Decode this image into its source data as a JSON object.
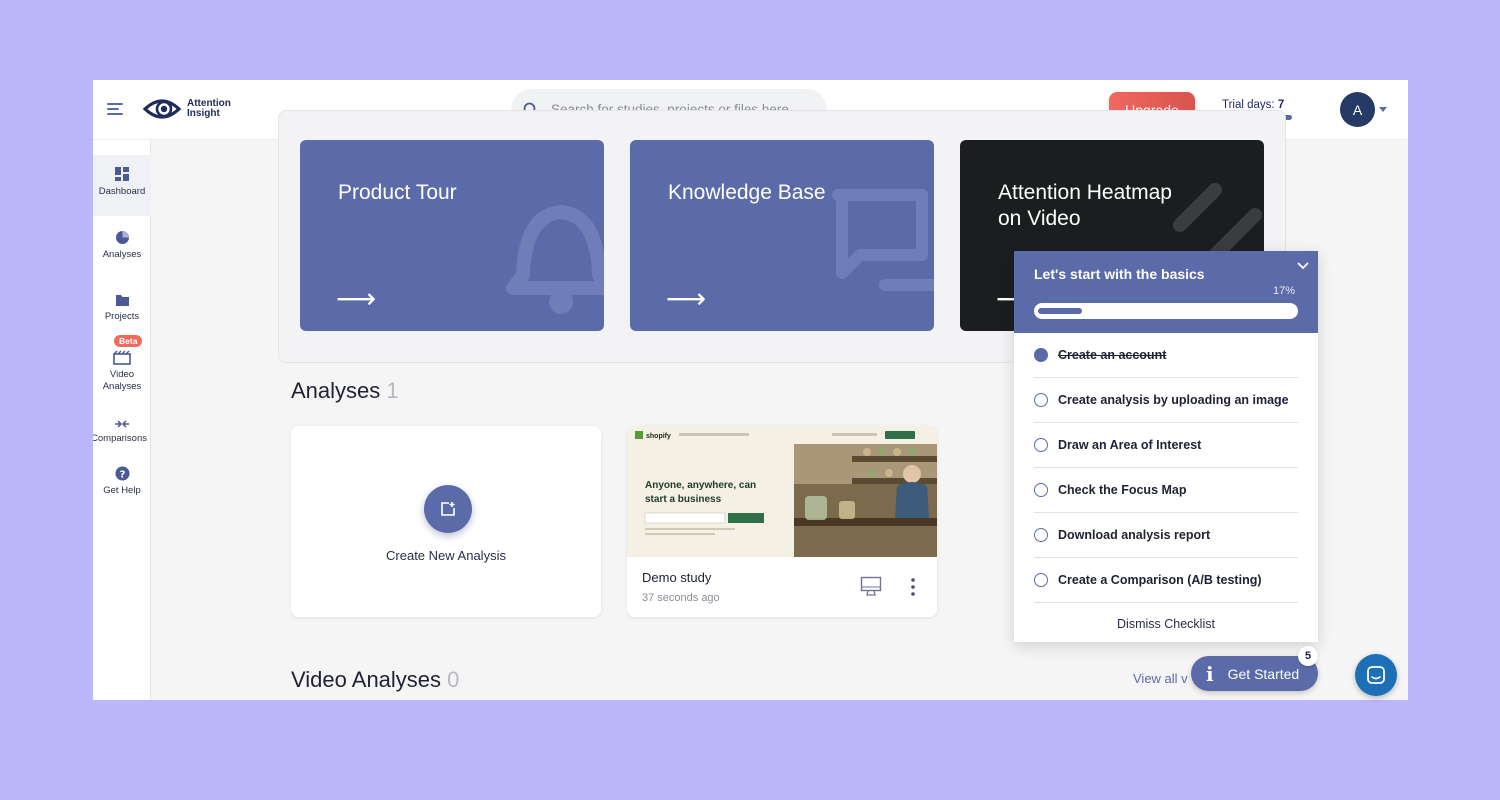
{
  "header": {
    "logo_text_line1": "Attention",
    "logo_text_line2": "Insight",
    "search_placeholder": "Search for studies, projects or files here...",
    "upgrade_label": "Upgrade",
    "trial_label": "Trial days: ",
    "trial_days": "7",
    "avatar_initial": "A"
  },
  "sidebar": {
    "items": [
      {
        "label": "Dashboard",
        "icon": "dashboard-icon"
      },
      {
        "label": "Analyses",
        "icon": "analyses-icon"
      },
      {
        "label": "Projects",
        "icon": "folder-icon"
      },
      {
        "label": "Video Analyses",
        "icon": "video-icon"
      },
      {
        "label": "Comparisons",
        "icon": "comparisons-icon"
      },
      {
        "label": "Get Help",
        "icon": "help-icon"
      }
    ],
    "beta_badge": "Beta"
  },
  "cards": [
    {
      "title": "Product Tour",
      "arrow": "⟶"
    },
    {
      "title": "Knowledge Base",
      "arrow": "⟶"
    },
    {
      "title": "Attention Heatmap on Video",
      "arrow": "⟶"
    }
  ],
  "analyses": {
    "title": "Analyses",
    "count": "1",
    "create_label": "Create New Analysis",
    "study": {
      "name": "Demo study",
      "time": "37 seconds ago",
      "thumb_headline": "Anyone, anywhere, can start a business",
      "thumb_brand": "shopify"
    }
  },
  "video_analyses": {
    "title": "Video Analyses",
    "count": "0",
    "view_all": "View all v"
  },
  "checklist": {
    "title": "Let's start with the basics",
    "progress_percent": 17,
    "progress_label": "17%",
    "items": [
      {
        "label": "Create an account",
        "done": true
      },
      {
        "label": "Create analysis by uploading an image",
        "done": false
      },
      {
        "label": "Draw an Area of Interest",
        "done": false
      },
      {
        "label": "Check the Focus Map",
        "done": false
      },
      {
        "label": "Download analysis report",
        "done": false
      },
      {
        "label": "Create a Comparison (A/B testing)",
        "done": false
      }
    ],
    "dismiss": "Dismiss Checklist"
  },
  "get_started": {
    "label": "Get Started",
    "badge": "5"
  },
  "colors": {
    "page_bg": "#bcb6fd",
    "accent": "#5b6ba9",
    "upgrade": "#e85c54",
    "dark_card": "#1b1e1f",
    "chat": "#1d6fb8"
  }
}
